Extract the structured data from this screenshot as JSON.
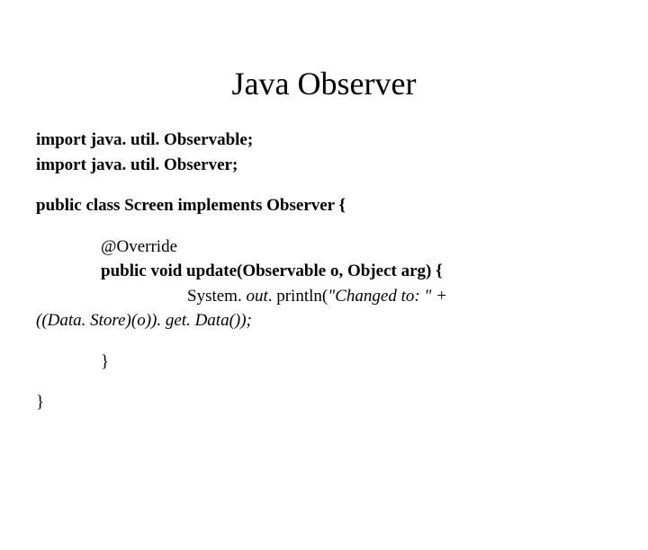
{
  "title": "Java Observer",
  "code": {
    "import1_kw": "import",
    "import1_rest": " java. util. Observable;",
    "import2_kw": "import",
    "import2_rest": " java. util. Observer;",
    "classdecl": "public class Screen implements Observer {",
    "override": "@Override",
    "method_sig": "public void update(Observable o, Object arg) {",
    "println_prefix": "System. ",
    "println_out": "out",
    "println_mid": ". println(",
    "println_str": "\"Changed to: \"",
    "println_plus": " +",
    "cast_line": "((Data. Store)(o)). get. Data());",
    "method_close": "}",
    "class_close": "}"
  }
}
